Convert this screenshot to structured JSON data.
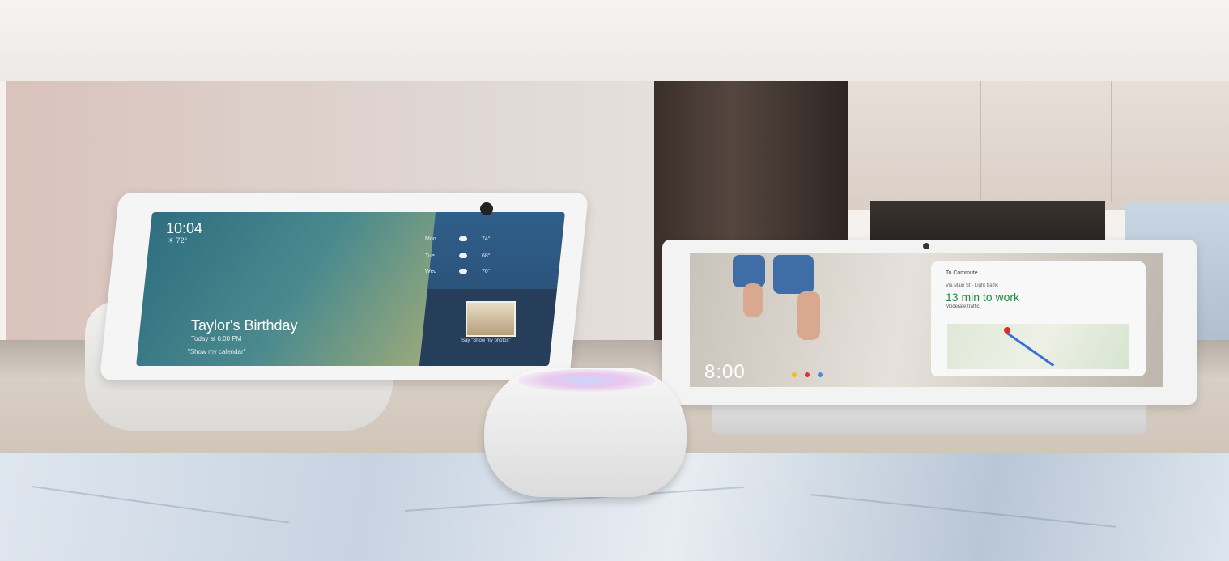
{
  "echo_show": {
    "time": "10:04",
    "temperature": "☀ 72°",
    "event_title": "Taylor's Birthday",
    "event_sub": "Today at 6:00 PM",
    "event_hint": "\"Show my calendar\"",
    "weather": [
      {
        "day": "Mon",
        "temp": "74°"
      },
      {
        "day": "Tue",
        "temp": "68°"
      },
      {
        "day": "Wed",
        "temp": "70°"
      }
    ],
    "photo_caption": "Say \"Show my photos\""
  },
  "nest_hub": {
    "time": "8:00",
    "card_label": "To Commute",
    "card_route": "Via Main St · Light traffic",
    "card_eta": "13 min to work",
    "card_traffic": "Moderate traffic",
    "dot_colors": [
      "#f4c20d",
      "#db3236",
      "#4885ed"
    ]
  },
  "colors": {
    "speaker_glow_a": "#c9d7ff",
    "speaker_glow_b": "#e8c6ee",
    "route_blue": "#3b6fd8",
    "pin_red": "#d93025",
    "eta_green": "#1e8e3e"
  }
}
